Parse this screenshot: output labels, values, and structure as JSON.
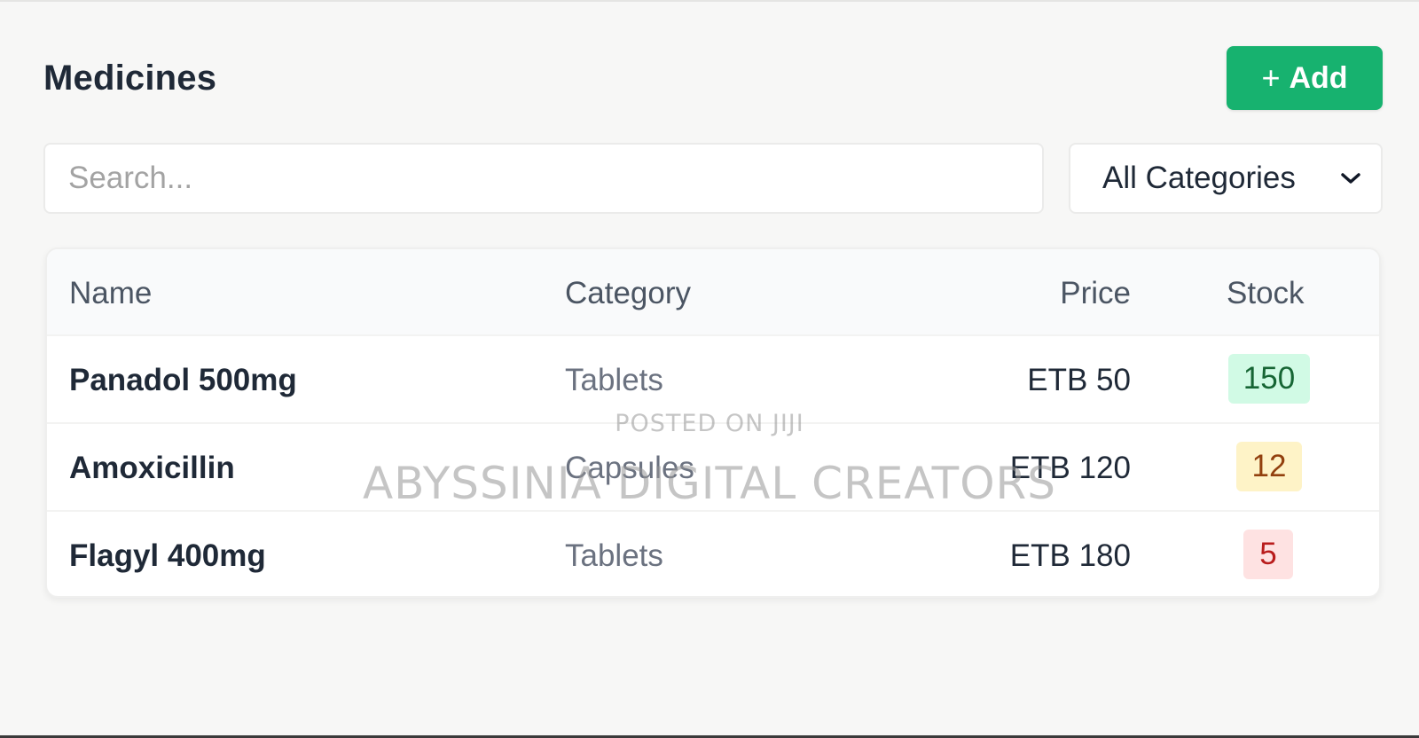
{
  "header": {
    "title": "Medicines",
    "add_button": {
      "icon": "plus-icon",
      "label": "Add",
      "icon_glyph": "+"
    }
  },
  "filters": {
    "search_placeholder": "Search...",
    "search_value": "",
    "category_selected": "All Categories"
  },
  "table": {
    "columns": [
      "Name",
      "Category",
      "Price",
      "Stock"
    ],
    "rows": [
      {
        "name": "Panadol 500mg",
        "category": "Tablets",
        "price": "ETB 50",
        "stock": "150",
        "stock_status": "green"
      },
      {
        "name": "Amoxicillin",
        "category": "Capsules",
        "price": "ETB 120",
        "stock": "12",
        "stock_status": "amber"
      },
      {
        "name": "Flagyl 400mg",
        "category": "Tablets",
        "price": "ETB 180",
        "stock": "5",
        "stock_status": "red"
      }
    ]
  },
  "watermark": {
    "line1": "POSTED ON JIJI",
    "line2": "ABYSSINIA DIGITAL CREATORS"
  },
  "colors": {
    "accent": "#17b26f",
    "stock_green_bg": "#d1fae5",
    "stock_amber_bg": "#fef3c7",
    "stock_red_bg": "#fee2e2"
  }
}
